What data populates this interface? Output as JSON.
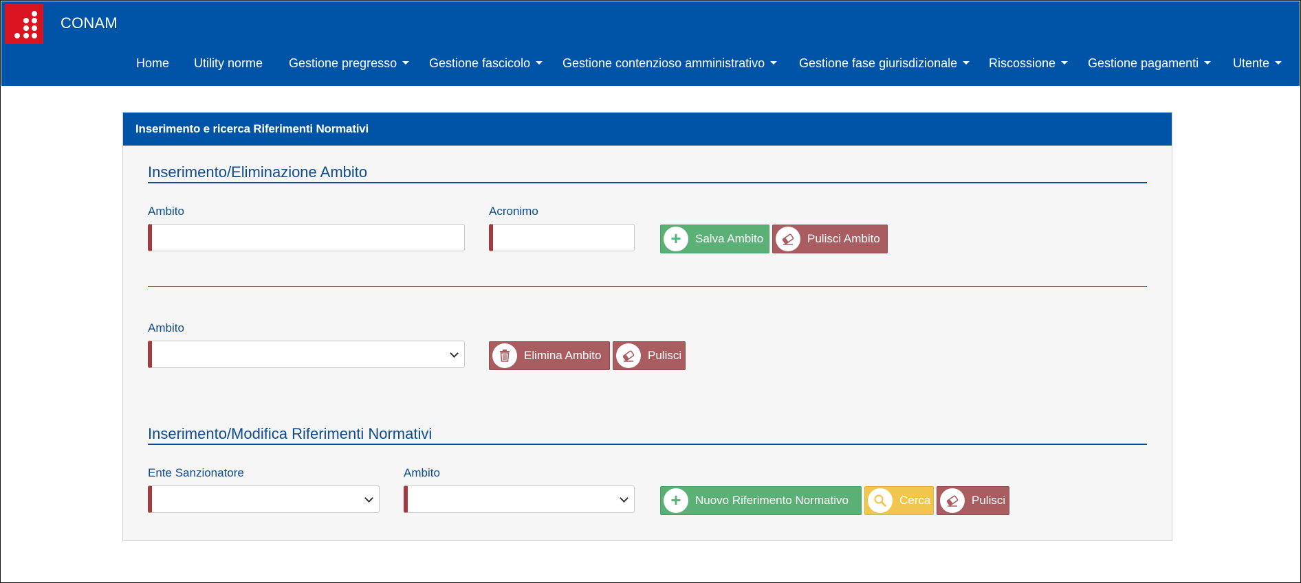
{
  "header": {
    "brand": "CONAM",
    "nav": [
      {
        "label": "Home",
        "dropdown": false
      },
      {
        "label": "Utility norme",
        "dropdown": false
      },
      {
        "label": "Gestione pregresso",
        "dropdown": true
      },
      {
        "label": "Gestione fascicolo",
        "dropdown": true
      },
      {
        "label": "Gestione contenzioso amministrativo",
        "dropdown": true
      },
      {
        "label": "Gestione fase giurisdizionale",
        "dropdown": true
      },
      {
        "label": "Riscossione",
        "dropdown": true
      },
      {
        "label": "Gestione pagamenti",
        "dropdown": true
      },
      {
        "label": "Utente",
        "dropdown": true
      }
    ]
  },
  "panel": {
    "title": "Inserimento e ricerca Riferimenti Normativi",
    "section1": {
      "title": "Inserimento/Eliminazione Ambito",
      "ambito_label": "Ambito",
      "ambito_value": "",
      "acronimo_label": "Acronimo",
      "acronimo_value": "",
      "salva_label": "Salva Ambito",
      "pulisci_label": "Pulisci Ambito"
    },
    "section2": {
      "ambito_label": "Ambito",
      "ambito_selected": "",
      "elimina_label": "Elimina Ambito",
      "pulisci_label": "Pulisci"
    },
    "section3": {
      "title": "Inserimento/Modifica Riferimenti Normativi",
      "ente_label": "Ente Sanzionatore",
      "ente_selected": "",
      "ambito_label": "Ambito",
      "ambito_selected": "",
      "nuovo_label": "Nuovo Riferimento Normativo",
      "cerca_label": "Cerca",
      "pulisci_label": "Pulisci"
    }
  },
  "colors": {
    "header_blue": "#0054a8",
    "logo_red": "#d7141f",
    "label_blue": "#0d4a8f",
    "btn_green": "#5bb075",
    "btn_red": "#a95d60",
    "btn_yellow": "#f0c64f",
    "required_marker": "#a23a3f"
  },
  "icons": {
    "salva": "plus-icon",
    "pulisci": "eraser-icon",
    "elimina": "trash-icon",
    "cerca": "search-icon",
    "select": "chevron-down-icon"
  }
}
